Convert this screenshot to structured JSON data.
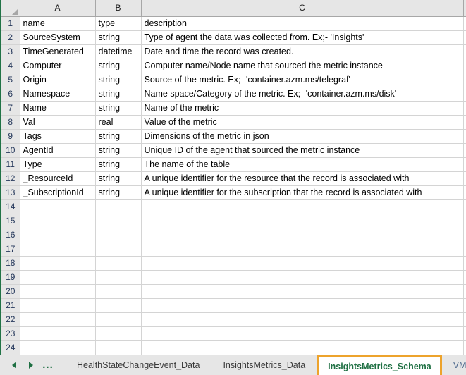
{
  "app": {
    "type": "spreadsheet",
    "select_all_icon": "select-all-triangle"
  },
  "grid": {
    "column_headers": [
      "A",
      "B",
      "C"
    ],
    "row_numbers": [
      1,
      2,
      3,
      4,
      5,
      6,
      7,
      8,
      9,
      10,
      11,
      12,
      13,
      14,
      15,
      16,
      17,
      18,
      19,
      20,
      21,
      22,
      23,
      24
    ],
    "rows": [
      {
        "n": 1,
        "a": "name",
        "b": "type",
        "c": "description"
      },
      {
        "n": 2,
        "a": "SourceSystem",
        "b": "string",
        "c": "Type of agent the data was collected from. Ex;- 'Insights'"
      },
      {
        "n": 3,
        "a": "TimeGenerated",
        "b": "datetime",
        "c": "Date and time the record was created."
      },
      {
        "n": 4,
        "a": "Computer",
        "b": "string",
        "c": "Computer name/Node name that sourced the metric instance"
      },
      {
        "n": 5,
        "a": "Origin",
        "b": "string",
        "c": "Source of the metric. Ex;- 'container.azm.ms/telegraf'"
      },
      {
        "n": 6,
        "a": "Namespace",
        "b": "string",
        "c": "Name space/Category of the metric. Ex;- 'container.azm.ms/disk'"
      },
      {
        "n": 7,
        "a": "Name",
        "b": "string",
        "c": "Name of the metric"
      },
      {
        "n": 8,
        "a": "Val",
        "b": "real",
        "c": "Value of the metric"
      },
      {
        "n": 9,
        "a": "Tags",
        "b": "string",
        "c": "Dimensions of the metric in json"
      },
      {
        "n": 10,
        "a": "AgentId",
        "b": "string",
        "c": "Unique ID of the agent that sourced the metric instance"
      },
      {
        "n": 11,
        "a": "Type",
        "b": "string",
        "c": "The name of the table"
      },
      {
        "n": 12,
        "a": "_ResourceId",
        "b": "string",
        "c": "A unique identifier for the resource that the record is associated with"
      },
      {
        "n": 13,
        "a": "_SubscriptionId",
        "b": "string",
        "c": "A unique identifier for the subscription that the record is associated with"
      },
      {
        "n": 14,
        "a": "",
        "b": "",
        "c": ""
      },
      {
        "n": 15,
        "a": "",
        "b": "",
        "c": ""
      },
      {
        "n": 16,
        "a": "",
        "b": "",
        "c": ""
      },
      {
        "n": 17,
        "a": "",
        "b": "",
        "c": ""
      },
      {
        "n": 18,
        "a": "",
        "b": "",
        "c": ""
      },
      {
        "n": 19,
        "a": "",
        "b": "",
        "c": ""
      },
      {
        "n": 20,
        "a": "",
        "b": "",
        "c": ""
      },
      {
        "n": 21,
        "a": "",
        "b": "",
        "c": ""
      },
      {
        "n": 22,
        "a": "",
        "b": "",
        "c": ""
      },
      {
        "n": 23,
        "a": "",
        "b": "",
        "c": ""
      },
      {
        "n": 24,
        "a": "",
        "b": "",
        "c": ""
      }
    ]
  },
  "tabbar": {
    "nav": {
      "prev_icon": "triangle-left-icon",
      "next_icon": "triangle-right-icon",
      "more_label": "..."
    },
    "tabs": [
      {
        "label": "HealthStateChangeEvent_Data",
        "active": false,
        "partial": false
      },
      {
        "label": "InsightsMetrics_Data",
        "active": false,
        "partial": false
      },
      {
        "label": "InsightsMetrics_Schema",
        "active": true,
        "partial": false
      },
      {
        "label": "VM",
        "active": false,
        "partial": true
      }
    ]
  },
  "colors": {
    "active_tab_border": "#eda32c",
    "active_tab_text": "#1f7043",
    "nav_arrow": "#1f7043",
    "header_bg": "#e6e6e6",
    "gridline": "#d4d4d4",
    "row_number_text": "#26395c"
  }
}
